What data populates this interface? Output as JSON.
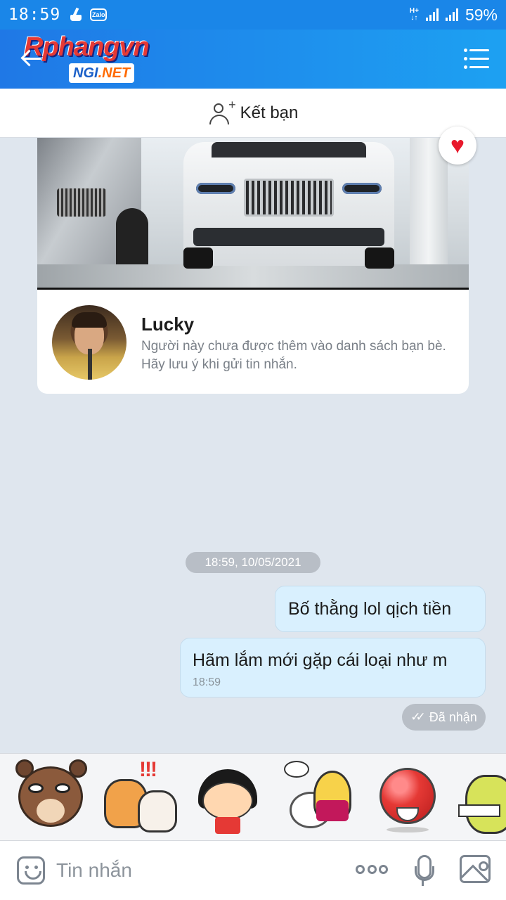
{
  "status_bar": {
    "time": "18:59",
    "network_type": "H+",
    "battery": "59%",
    "icons": [
      "broom-icon",
      "zalo-icon",
      "signal-icon",
      "signal-icon"
    ]
  },
  "header": {
    "logo_brand": "Rphangvn",
    "logo_sub_ngi": "NGI",
    "logo_sub_net": ".NET",
    "icons": [
      "back-arrow-icon",
      "menu-icon"
    ]
  },
  "friend_bar": {
    "label": "Kết bạn",
    "icon": "add-user-icon"
  },
  "profile_card": {
    "name": "Lucky",
    "notice": "Người này chưa được thêm vào danh sách bạn bè. Hãy lưu ý khi gửi tin nhắn.",
    "reaction_icon": "heart-icon"
  },
  "chat": {
    "timestamp": "18:59, 10/05/2021",
    "messages": [
      {
        "text": "Bố thằng lol qịch tiền",
        "time": ""
      },
      {
        "text": "Hãm lắm mới gặp cái loại như m",
        "time": "18:59"
      }
    ],
    "status": "Đã nhận"
  },
  "sticker_tray": {
    "stickers": [
      "raccoon-sticker",
      "shocked-cats-sticker",
      "girl-sticker",
      "toilet-fox-sticker",
      "red-ball-sticker",
      "crocodile-sticker"
    ]
  },
  "input_bar": {
    "placeholder": "Tin nhắn",
    "icons": [
      "emoji-icon",
      "more-icon",
      "mic-icon",
      "image-icon"
    ]
  },
  "colors": {
    "header_start": "#1f78e6",
    "header_end": "#1da1f2",
    "chat_background": "#dfe6ee",
    "outgoing_bubble": "#d9f0fe",
    "heart": "#e8192c"
  }
}
